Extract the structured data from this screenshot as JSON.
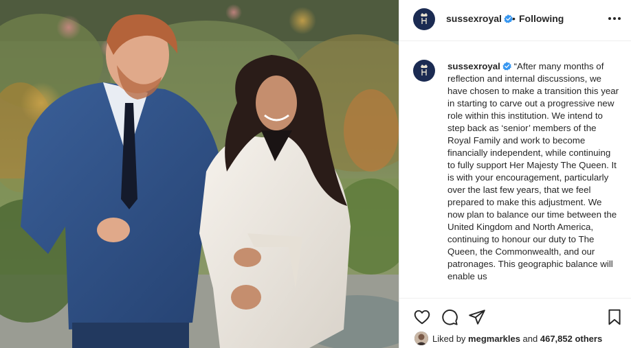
{
  "photo": {
    "description_icon": "couple-walking-photo"
  },
  "header": {
    "username": "sussexroyal",
    "separator": "•",
    "follow_state": "Following",
    "more_icon": "more-options-icon"
  },
  "caption": {
    "username": "sussexroyal",
    "text": "“After many months of reflection and internal discussions, we have chosen to make a transition this year in starting to carve out a progressive new role within this institution. We intend to step back as ‘senior’ members of the Royal Family and work to become financially independent, while continuing to fully support Her Majesty The Queen. It is with your encouragement, particularly over the last few years, that we feel prepared to make this adjustment. We now plan to balance our time between the United Kingdom and North America, continuing to honour our duty to The Queen, the Commonwealth, and our patronages. This geographic balance will enable us"
  },
  "likes": {
    "prefix": "Liked by ",
    "user": "megmarkles",
    "middle": " and ",
    "count": "467,852 others"
  },
  "colors": {
    "verified": "#3897f0",
    "avatar_bg": "#1b2b52",
    "text": "#262626",
    "divider": "#efefef"
  }
}
